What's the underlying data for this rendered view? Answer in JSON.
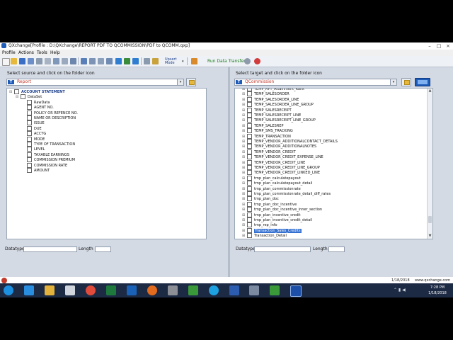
{
  "window": {
    "title": "QXchange[Profile : D:\\QXchange\\REPORT PDF TO QCOMMISSION\\PDF to QCOMM.qxp]",
    "controls": {
      "minimize": "–",
      "maximize": "□",
      "close": "×"
    }
  },
  "menu": [
    "Profile",
    "Actions",
    "Tools",
    "Help"
  ],
  "toolbar": {
    "upsert_label_1": "Upsert",
    "upsert_label_2": "Mode",
    "run_label": "Run Data Transfer",
    "icons": [
      "new-icon",
      "open-icon",
      "save-icon",
      "save-as-icon",
      "print-icon",
      "copy-icon",
      "grid-icon",
      "delete-icon",
      "undo-icon",
      "redo-icon",
      "filter-icon",
      "refresh-icon",
      "filter-icon",
      "swap-icon",
      "settings-icon",
      "run-icon",
      "close-icon"
    ]
  },
  "source": {
    "label": "Select source and click on the folder icon",
    "combo_value": "Report",
    "tree": [
      {
        "text": "ACCOUNT STATEMENT",
        "level": 0,
        "root": true,
        "check": true,
        "expander": "⊟"
      },
      {
        "text": "DataSet",
        "level": 1,
        "check": true,
        "expander": "⊟"
      },
      {
        "text": "RawData",
        "level": 2,
        "check": true,
        "expander": ""
      },
      {
        "text": "AGENT NO.",
        "level": 2,
        "check": true,
        "expander": ""
      },
      {
        "text": "POLICY OR REFENCE NO.",
        "level": 2,
        "check": true,
        "expander": ""
      },
      {
        "text": "NAME OR DESCRIPTION",
        "level": 2,
        "check": true,
        "expander": ""
      },
      {
        "text": "ISSUE",
        "level": 2,
        "check": true,
        "expander": ""
      },
      {
        "text": "DUE",
        "level": 2,
        "check": true,
        "expander": ""
      },
      {
        "text": "ACCTG",
        "level": 2,
        "check": true,
        "expander": ""
      },
      {
        "text": "MODE",
        "level": 2,
        "check": true,
        "expander": ""
      },
      {
        "text": "TYPE OF TRANSACTION",
        "level": 2,
        "check": true,
        "expander": ""
      },
      {
        "text": "LEVEL",
        "level": 2,
        "check": true,
        "expander": ""
      },
      {
        "text": "TAXABLE EARNINGS",
        "level": 2,
        "check": true,
        "expander": ""
      },
      {
        "text": "COMMISSION PREMIUM",
        "level": 2,
        "check": true,
        "expander": ""
      },
      {
        "text": "COMMISSION RATE",
        "level": 2,
        "check": true,
        "expander": ""
      },
      {
        "text": "AMOUNT",
        "level": 2,
        "check": true,
        "expander": ""
      }
    ],
    "datatype_label": "Datatype",
    "length_label": "Length"
  },
  "target": {
    "label": "Select target and click on the folder icon",
    "combo_value": "QCommission",
    "tree": [
      {
        "text": "TEMP_RPT_Attainment_Rank",
        "selected": false
      },
      {
        "text": "TEMP_SALESORDER",
        "selected": false
      },
      {
        "text": "TEMP_SALESORDER_LINE",
        "selected": false
      },
      {
        "text": "TEMP_SALESORDER_LINE_GROUP",
        "selected": false
      },
      {
        "text": "TEMP_SALESRECEIPT",
        "selected": false
      },
      {
        "text": "TEMP_SALESRECEIPT_LINE",
        "selected": false
      },
      {
        "text": "TEMP_SALESRECEIPT_LINE_GROUP",
        "selected": false
      },
      {
        "text": "TEMP_SALESREP",
        "selected": false
      },
      {
        "text": "TEMP_SMS_TRACKING",
        "selected": false
      },
      {
        "text": "TEMP_TRANSACTION",
        "selected": false
      },
      {
        "text": "TEMP_VENDOR_ADDITIONALCONTACT_DETAILS",
        "selected": false
      },
      {
        "text": "TEMP_VENDOR_ADDITIONALNOTES",
        "selected": false
      },
      {
        "text": "TEMP_VENDOR_CREDIT",
        "selected": false
      },
      {
        "text": "TEMP_VENDOR_CREDIT_EXPENSE_LINE",
        "selected": false
      },
      {
        "text": "TEMP_VENDOR_CREDIT_LINE",
        "selected": false
      },
      {
        "text": "TEMP_VENDOR_CREDIT_LINE_GROUP",
        "selected": false
      },
      {
        "text": "TEMP_VENDOR_CREDIT_LINKED_LINE",
        "selected": false
      },
      {
        "text": "tmp_plan_calculatepayout",
        "selected": false
      },
      {
        "text": "tmp_plan_calculatepayout_detail",
        "selected": false
      },
      {
        "text": "tmp_plan_commissionrate",
        "selected": false
      },
      {
        "text": "tmp_plan_commissionrate_detail_diff_rates",
        "selected": false
      },
      {
        "text": "tmp_plan_doc",
        "selected": false
      },
      {
        "text": "tmp_plan_doc_incentive",
        "selected": false
      },
      {
        "text": "tmp_plan_doc_incentive_inner_section",
        "selected": false
      },
      {
        "text": "tmp_plan_incentive_credit",
        "selected": false
      },
      {
        "text": "tmp_plan_incentive_credit_detail",
        "selected": false
      },
      {
        "text": "tmp_rep_info",
        "selected": false
      },
      {
        "text": "Transaction_Sales_Credits",
        "selected": true
      },
      {
        "text": "Transaction_Detail",
        "selected": false
      }
    ],
    "datatype_label": "Datatype",
    "length_label": "Length"
  },
  "statusbar": {
    "date": "1/18/2018",
    "site": "www.qxchange.com"
  },
  "taskbar": {
    "time": "7:28 PM",
    "date": "1/18/2018",
    "apps": [
      "windows-start-icon",
      "ie-icon",
      "file-explorer-icon",
      "media-player-icon",
      "chrome-icon",
      "excel-icon",
      "outlook-icon",
      "firefox-icon",
      "tools-icon",
      "camtasia-icon",
      "skype-icon",
      "word-icon",
      "notepad-icon",
      "camtasia-recorder-icon",
      "qxchange-icon"
    ]
  },
  "colors": {
    "accent": "#1e5bb8",
    "selection": "#3470d0",
    "panel_bg": "#d4dae4",
    "combo_text": "#c0392b",
    "run_text": "#1a7a1a"
  }
}
